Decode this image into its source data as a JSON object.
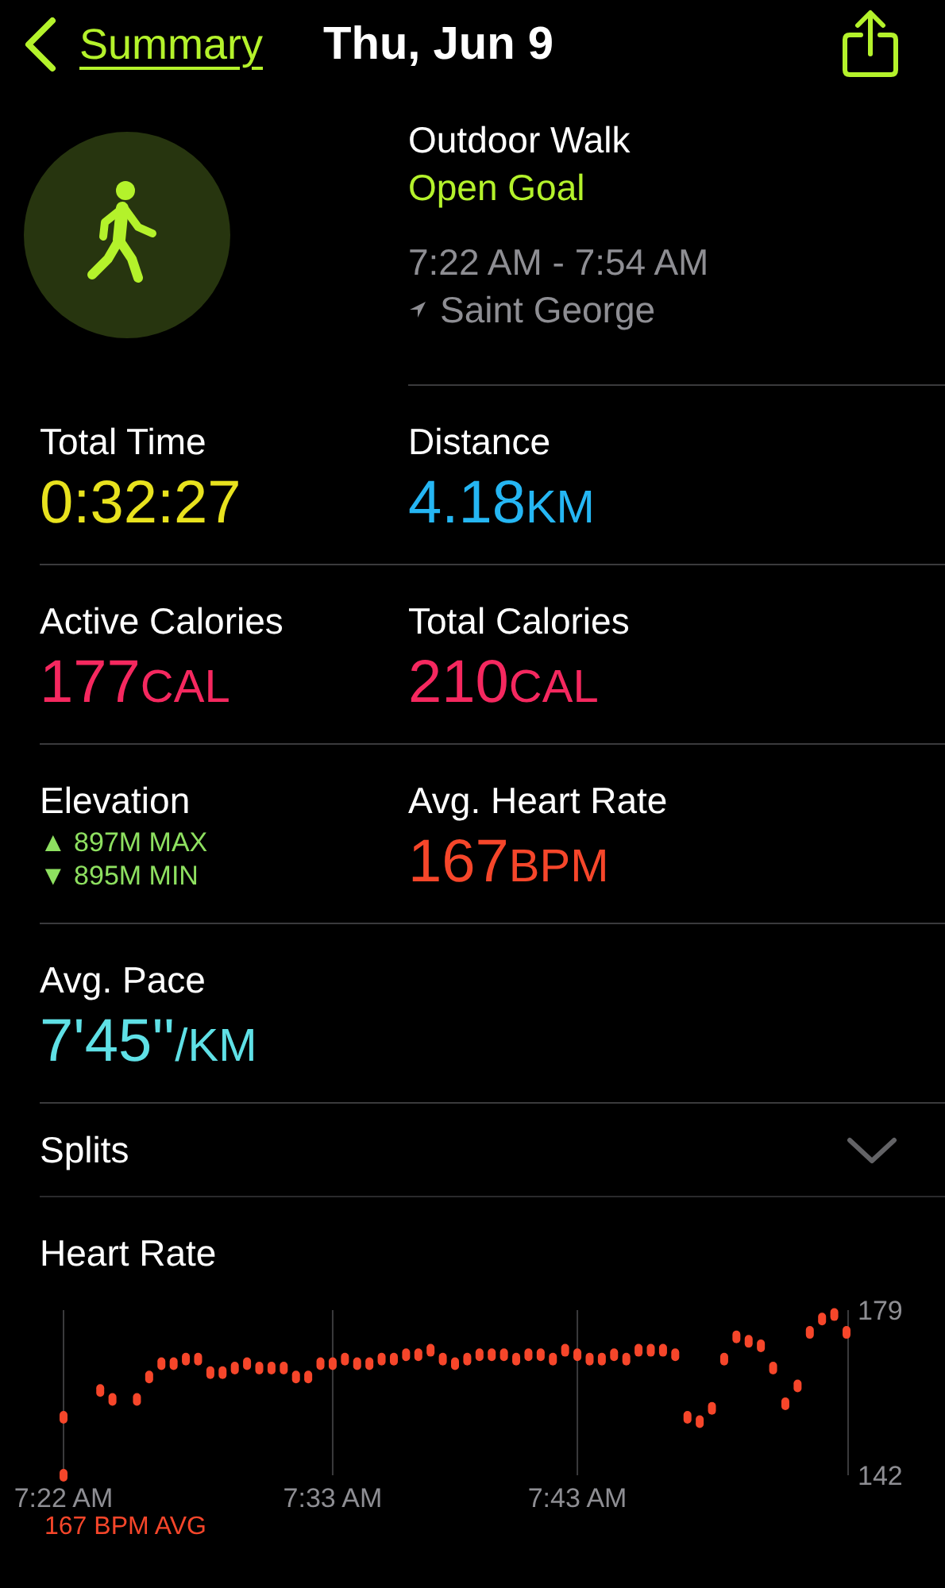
{
  "nav": {
    "back_label": "Summary",
    "title": "Thu, Jun 9"
  },
  "workout": {
    "name": "Outdoor Walk",
    "goal": "Open Goal",
    "time_range": "7:22 AM - 7:54 AM",
    "location": "Saint George"
  },
  "stats": [
    {
      "kind": "value",
      "label": "Total Time",
      "value": "0:32:27",
      "color": "#e8e21e"
    },
    {
      "kind": "value",
      "label": "Distance",
      "value": "4.18",
      "unit": "KM",
      "color": "#25b6f3"
    },
    {
      "kind": "value",
      "label": "Active Calories",
      "value": "177",
      "unit": "CAL",
      "color": "#f5285f"
    },
    {
      "kind": "value",
      "label": "Total Calories",
      "value": "210",
      "unit": "CAL",
      "color": "#f5285f"
    },
    {
      "kind": "elevation",
      "label": "Elevation",
      "lines": [
        "▲ 897M MAX",
        "▼ 895M MIN"
      ],
      "color": "#8ee060"
    },
    {
      "kind": "value",
      "label": "Avg. Heart Rate",
      "value": "167",
      "unit": "BPM",
      "color": "#f6462a"
    },
    {
      "kind": "value",
      "label": "Avg. Pace",
      "value": "7'45''",
      "unit": "/KM",
      "color": "#5fe0e6"
    }
  ],
  "splits": {
    "label": "Splits",
    "expanded": false
  },
  "heart_rate": {
    "average": "167 BPM AVG",
    "chart_data": {
      "type": "scatter",
      "title": "Heart Rate",
      "ylim": [
        142,
        179
      ],
      "yticks": [
        142,
        179
      ],
      "grid": true,
      "categories": [
        "7:22 AM",
        null,
        null,
        null,
        null,
        null,
        null,
        null,
        null,
        null,
        null,
        null,
        null,
        null,
        null,
        null,
        null,
        null,
        null,
        null,
        null,
        null,
        "7:33 AM",
        null,
        null,
        null,
        null,
        null,
        null,
        null,
        null,
        null,
        null,
        null,
        null,
        null,
        null,
        null,
        null,
        null,
        null,
        null,
        "7:43 AM",
        null,
        null,
        null,
        null,
        null,
        null,
        null,
        null,
        null,
        null,
        null,
        null,
        null,
        null,
        null,
        null,
        null,
        null,
        null,
        null,
        null,
        null
      ],
      "series": [
        {
          "color": "#f6462a",
          "values": [
            155,
            null,
            null,
            161,
            159,
            null,
            159,
            164,
            167,
            167,
            168,
            168,
            165,
            165,
            166,
            167,
            166,
            166,
            166,
            164,
            164,
            167,
            167,
            168,
            167,
            167,
            168,
            168,
            169,
            169,
            170,
            168,
            167,
            168,
            169,
            169,
            169,
            168,
            169,
            169,
            168,
            170,
            169,
            168,
            168,
            169,
            168,
            170,
            170,
            170,
            169,
            155,
            154,
            157,
            168,
            173,
            172,
            171,
            166,
            158,
            162,
            174,
            177,
            178,
            174
          ]
        },
        {
          "color": "#f6462a",
          "values": [
            142,
            null,
            null,
            null,
            null,
            null,
            null,
            null,
            null,
            null,
            null,
            null,
            null,
            null,
            null,
            null,
            null,
            null,
            null,
            null,
            null,
            null,
            null,
            null,
            null,
            null,
            null,
            null,
            null,
            null,
            null,
            null,
            null,
            null,
            null,
            null,
            null,
            null,
            null,
            null,
            null,
            null,
            null,
            null,
            null,
            null,
            null,
            null,
            null,
            null,
            null,
            null,
            null,
            null,
            null,
            null,
            null,
            null,
            null,
            null,
            null,
            null,
            null,
            null,
            null
          ]
        }
      ]
    }
  }
}
